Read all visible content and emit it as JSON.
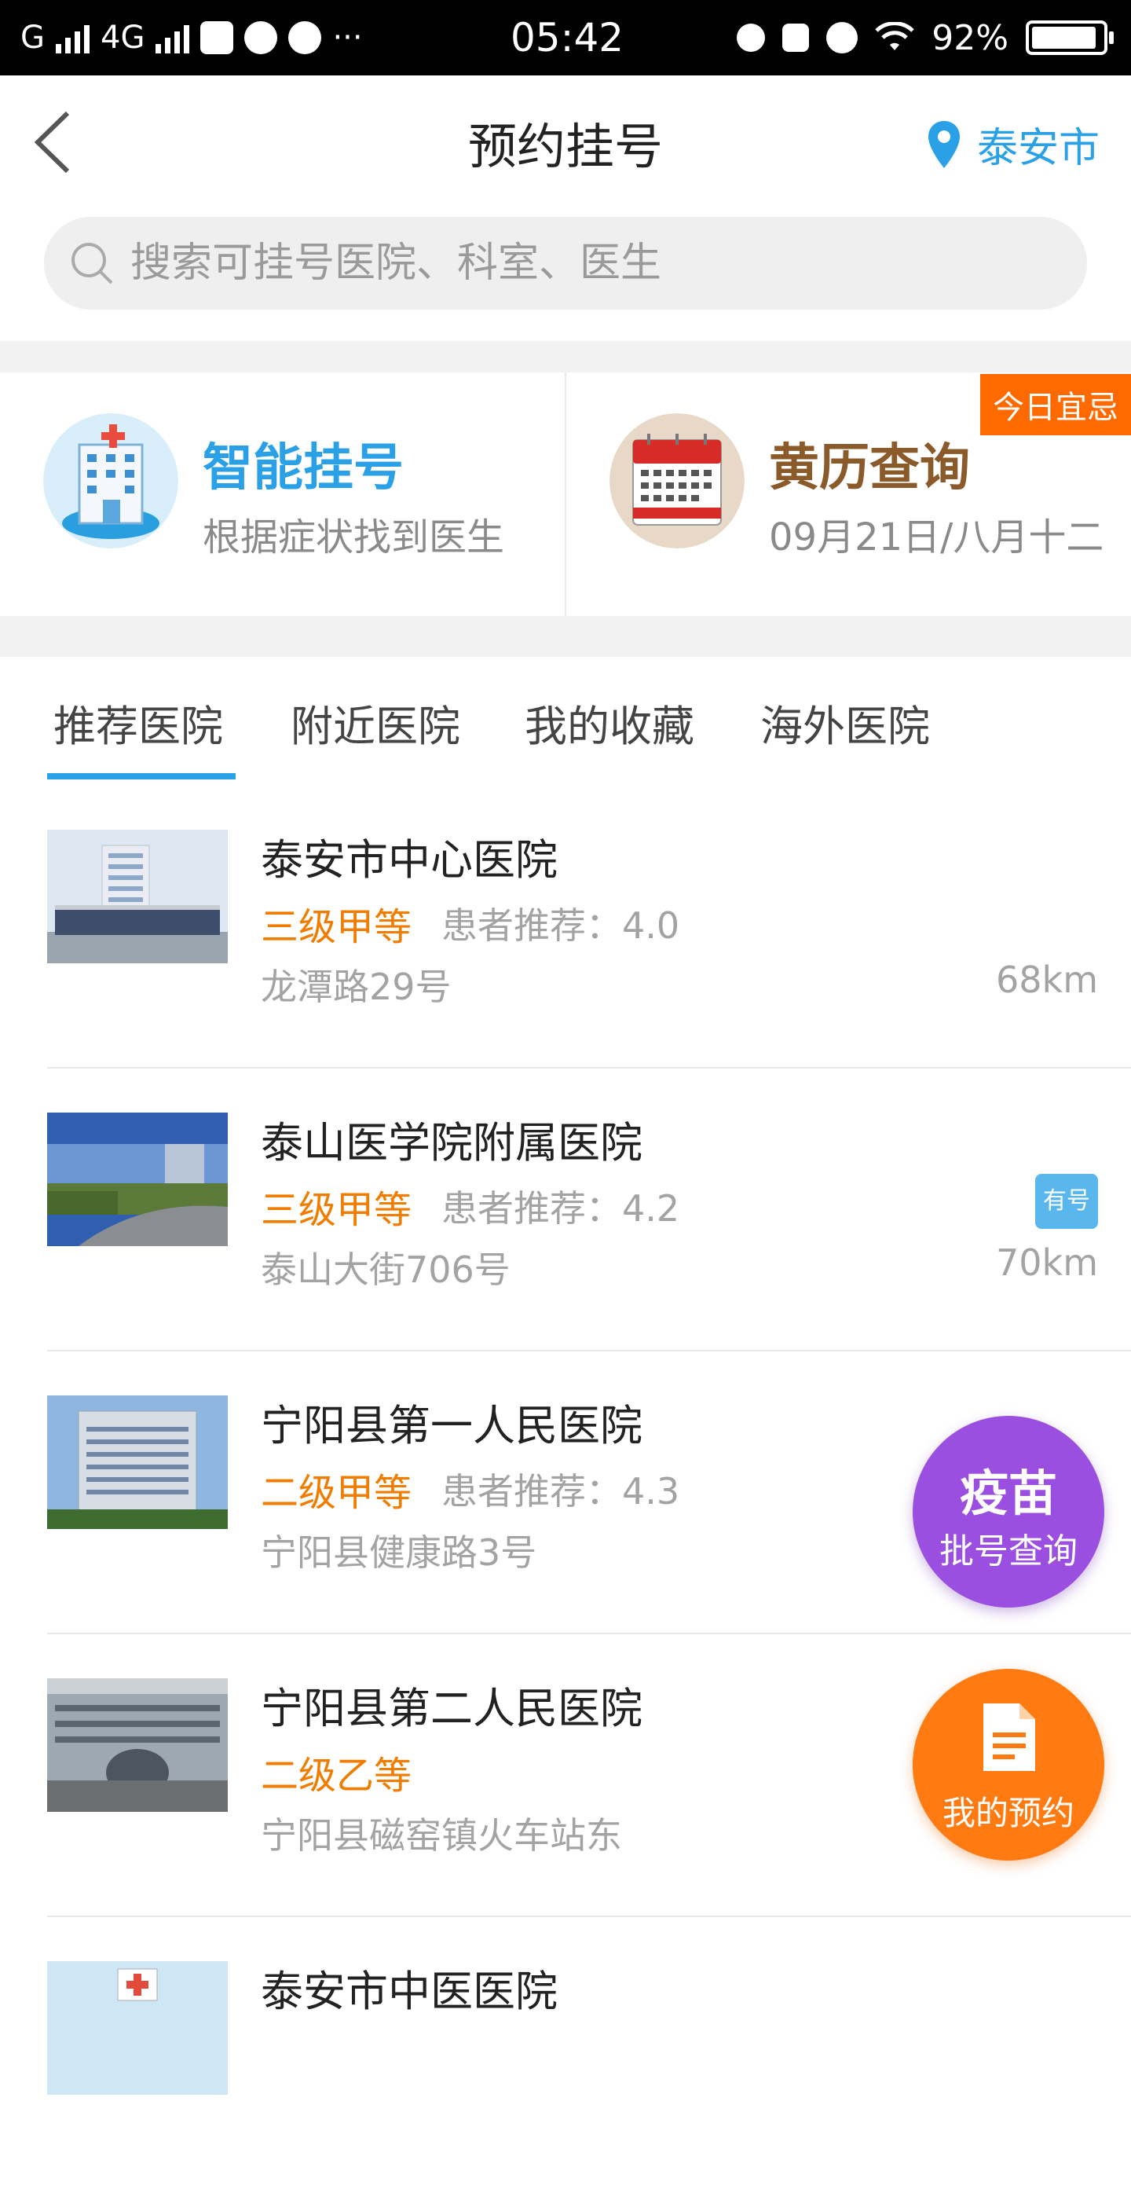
{
  "status_bar": {
    "network1": "G",
    "network2": "4G",
    "more": "···",
    "time": "05:42",
    "battery": "92%",
    "battery_level": 0.92
  },
  "header": {
    "title": "预约挂号",
    "location": "泰安市"
  },
  "search": {
    "placeholder": "搜索可挂号医院、科室、医生"
  },
  "cards": [
    {
      "title": "智能挂号",
      "subtitle": "根据症状找到医生",
      "title_color": "#2aa0e6"
    },
    {
      "title": "黄历查询",
      "subtitle": "09月21日/八月十二",
      "title_color": "#8a5a2a",
      "badge": "今日宜忌"
    }
  ],
  "tabs": [
    {
      "label": "推荐医院",
      "active": true
    },
    {
      "label": "附近医院",
      "active": false
    },
    {
      "label": "我的收藏",
      "active": false
    },
    {
      "label": "海外医院",
      "active": false
    }
  ],
  "hospitals": [
    {
      "name": "泰安市中心医院",
      "level": "三级甲等",
      "recommend": "患者推荐：4.0",
      "address": "龙潭路29号",
      "distance": "68km",
      "has_slot": false
    },
    {
      "name": "泰山医学院附属医院",
      "level": "三级甲等",
      "recommend": "患者推荐：4.2",
      "address": "泰山大街706号",
      "distance": "70km",
      "has_slot": true,
      "slot_badge": "有号"
    },
    {
      "name": "宁阳县第一人民医院",
      "level": "二级甲等",
      "recommend": "患者推荐：4.3",
      "address": "宁阳县健康路3号",
      "distance": "",
      "has_slot": false
    },
    {
      "name": "宁阳县第二人民医院",
      "level": "二级乙等",
      "recommend": "",
      "address": "宁阳县磁窑镇火车站东",
      "distance": "",
      "has_slot": false
    },
    {
      "name": "泰安市中医医院",
      "level": "",
      "recommend": "",
      "address": "",
      "distance": "",
      "has_slot": false
    }
  ],
  "fab": {
    "vaccine_line1": "疫苗",
    "vaccine_line2": "批号查询",
    "appointment": "我的预约"
  },
  "colors": {
    "accent": "#2aa0e6",
    "orange": "#f07d00",
    "vaccine": "#9b4fe0",
    "appointment": "#ff7a10"
  }
}
